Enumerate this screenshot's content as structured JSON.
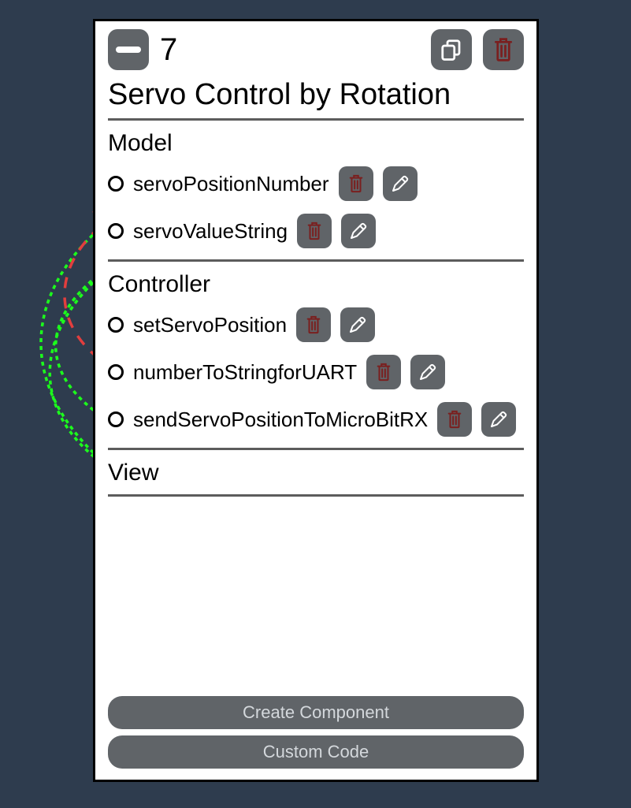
{
  "panel": {
    "number": "7",
    "title": "Servo Control by Rotation"
  },
  "sections": {
    "model": {
      "label": "Model",
      "items": [
        {
          "label": "servoPositionNumber"
        },
        {
          "label": "servoValueString"
        }
      ]
    },
    "controller": {
      "label": "Controller",
      "items": [
        {
          "label": "setServoPosition"
        },
        {
          "label": "numberToStringforUART"
        },
        {
          "label": "sendServoPositionToMicroBitRX"
        }
      ]
    },
    "view": {
      "label": "View"
    }
  },
  "footer": {
    "create": "Create Component",
    "custom": "Custom Code"
  },
  "colors": {
    "link_green": "#1cff1c",
    "link_red": "#e23e3e",
    "trash_red": "#7a1f1f"
  }
}
